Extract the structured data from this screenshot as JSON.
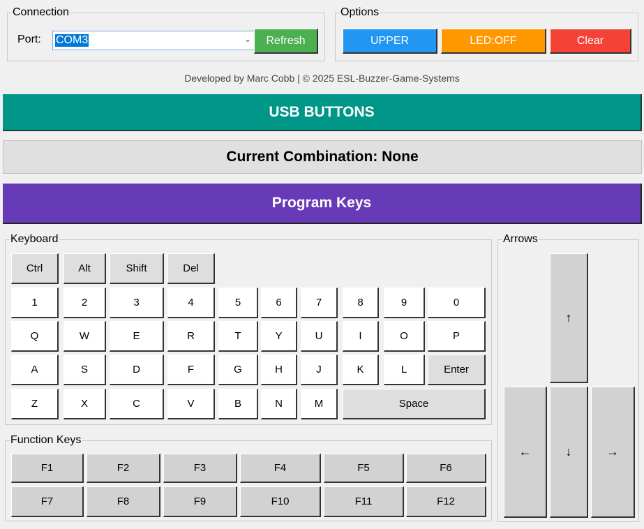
{
  "connection": {
    "title": "Connection",
    "port_label": "Port:",
    "port_value": "COM3",
    "refresh_label": "Refresh"
  },
  "options": {
    "title": "Options",
    "upper_label": "UPPER",
    "led_label": "LED:OFF",
    "clear_label": "Clear"
  },
  "credits": "Developed by Marc Cobb | © 2025 ESL-Buzzer-Game-Systems",
  "banners": {
    "usb_buttons": "USB BUTTONS",
    "current_combination": "Current Combination: None",
    "program_keys": "Program Keys"
  },
  "colors": {
    "refresh": "#4caf50",
    "upper": "#2196f3",
    "led": "#ff9800",
    "clear": "#f44336",
    "usb_banner": "#009688",
    "program_banner": "#673ab7"
  },
  "keyboard": {
    "title": "Keyboard",
    "modifiers": [
      "Ctrl",
      "Alt",
      "Shift",
      "Del"
    ],
    "row_numbers": [
      "1",
      "2",
      "3",
      "4",
      "5",
      "6",
      "7",
      "8",
      "9",
      "0"
    ],
    "row_q": [
      "Q",
      "W",
      "E",
      "R",
      "T",
      "Y",
      "U",
      "I",
      "O",
      "P"
    ],
    "row_a": [
      "A",
      "S",
      "D",
      "F",
      "G",
      "H",
      "J",
      "K",
      "L",
      "Enter"
    ],
    "row_z": [
      "Z",
      "X",
      "C",
      "V",
      "B",
      "N",
      "M",
      "Space"
    ]
  },
  "function_keys": {
    "title": "Function Keys",
    "row1": [
      "F1",
      "F2",
      "F3",
      "F4",
      "F5",
      "F6"
    ],
    "row2": [
      "F7",
      "F8",
      "F9",
      "F10",
      "F11",
      "F12"
    ]
  },
  "arrows": {
    "title": "Arrows",
    "up": "↑",
    "left": "←",
    "down": "↓",
    "right": "→"
  }
}
